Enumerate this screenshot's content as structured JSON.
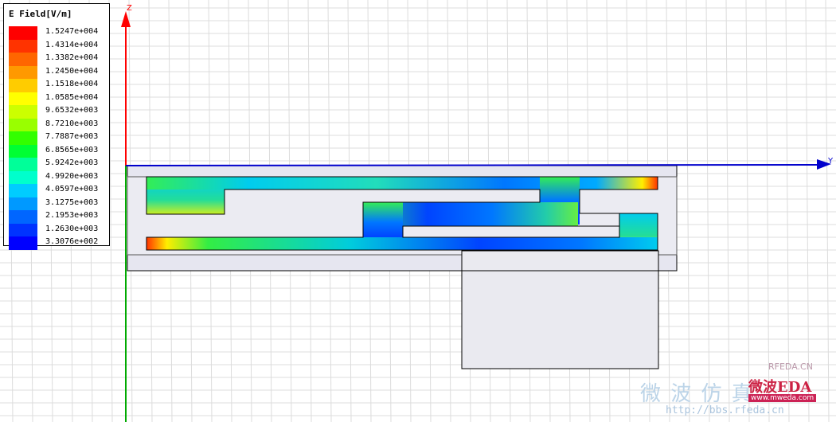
{
  "legend": {
    "title": "E Field[V/m]",
    "entries": [
      {
        "label": "1.5247e+004",
        "color": "#ff0000"
      },
      {
        "label": "1.4314e+004",
        "color": "#ff3300"
      },
      {
        "label": "1.3382e+004",
        "color": "#ff6600"
      },
      {
        "label": "1.2450e+004",
        "color": "#ff9900"
      },
      {
        "label": "1.1518e+004",
        "color": "#ffcc00"
      },
      {
        "label": "1.0585e+004",
        "color": "#ffff00"
      },
      {
        "label": "9.6532e+003",
        "color": "#ccff00"
      },
      {
        "label": "8.7210e+003",
        "color": "#99ff00"
      },
      {
        "label": "7.7887e+003",
        "color": "#33ff00"
      },
      {
        "label": "6.8565e+003",
        "color": "#00ff33"
      },
      {
        "label": "5.9242e+003",
        "color": "#00ff99"
      },
      {
        "label": "4.9920e+003",
        "color": "#00ffcc"
      },
      {
        "label": "4.0597e+003",
        "color": "#00ccff"
      },
      {
        "label": "3.1275e+003",
        "color": "#0099ff"
      },
      {
        "label": "2.1953e+003",
        "color": "#0066ff"
      },
      {
        "label": "1.2630e+003",
        "color": "#0033ff"
      },
      {
        "label": "3.3076e+002",
        "color": "#0000ff"
      }
    ]
  },
  "axes": {
    "z_label": "Z",
    "y_label": "Y",
    "z_color": "#ff0000",
    "y_color": "#0000cc",
    "x_color": "#00aa00"
  },
  "watermark": {
    "site": "RFEDA.CN",
    "url": "http://bbs.rfeda.cn",
    "brand": "微波EDA",
    "brand_url": "www.mweda.com",
    "cn_text": "微 波 仿 真"
  }
}
